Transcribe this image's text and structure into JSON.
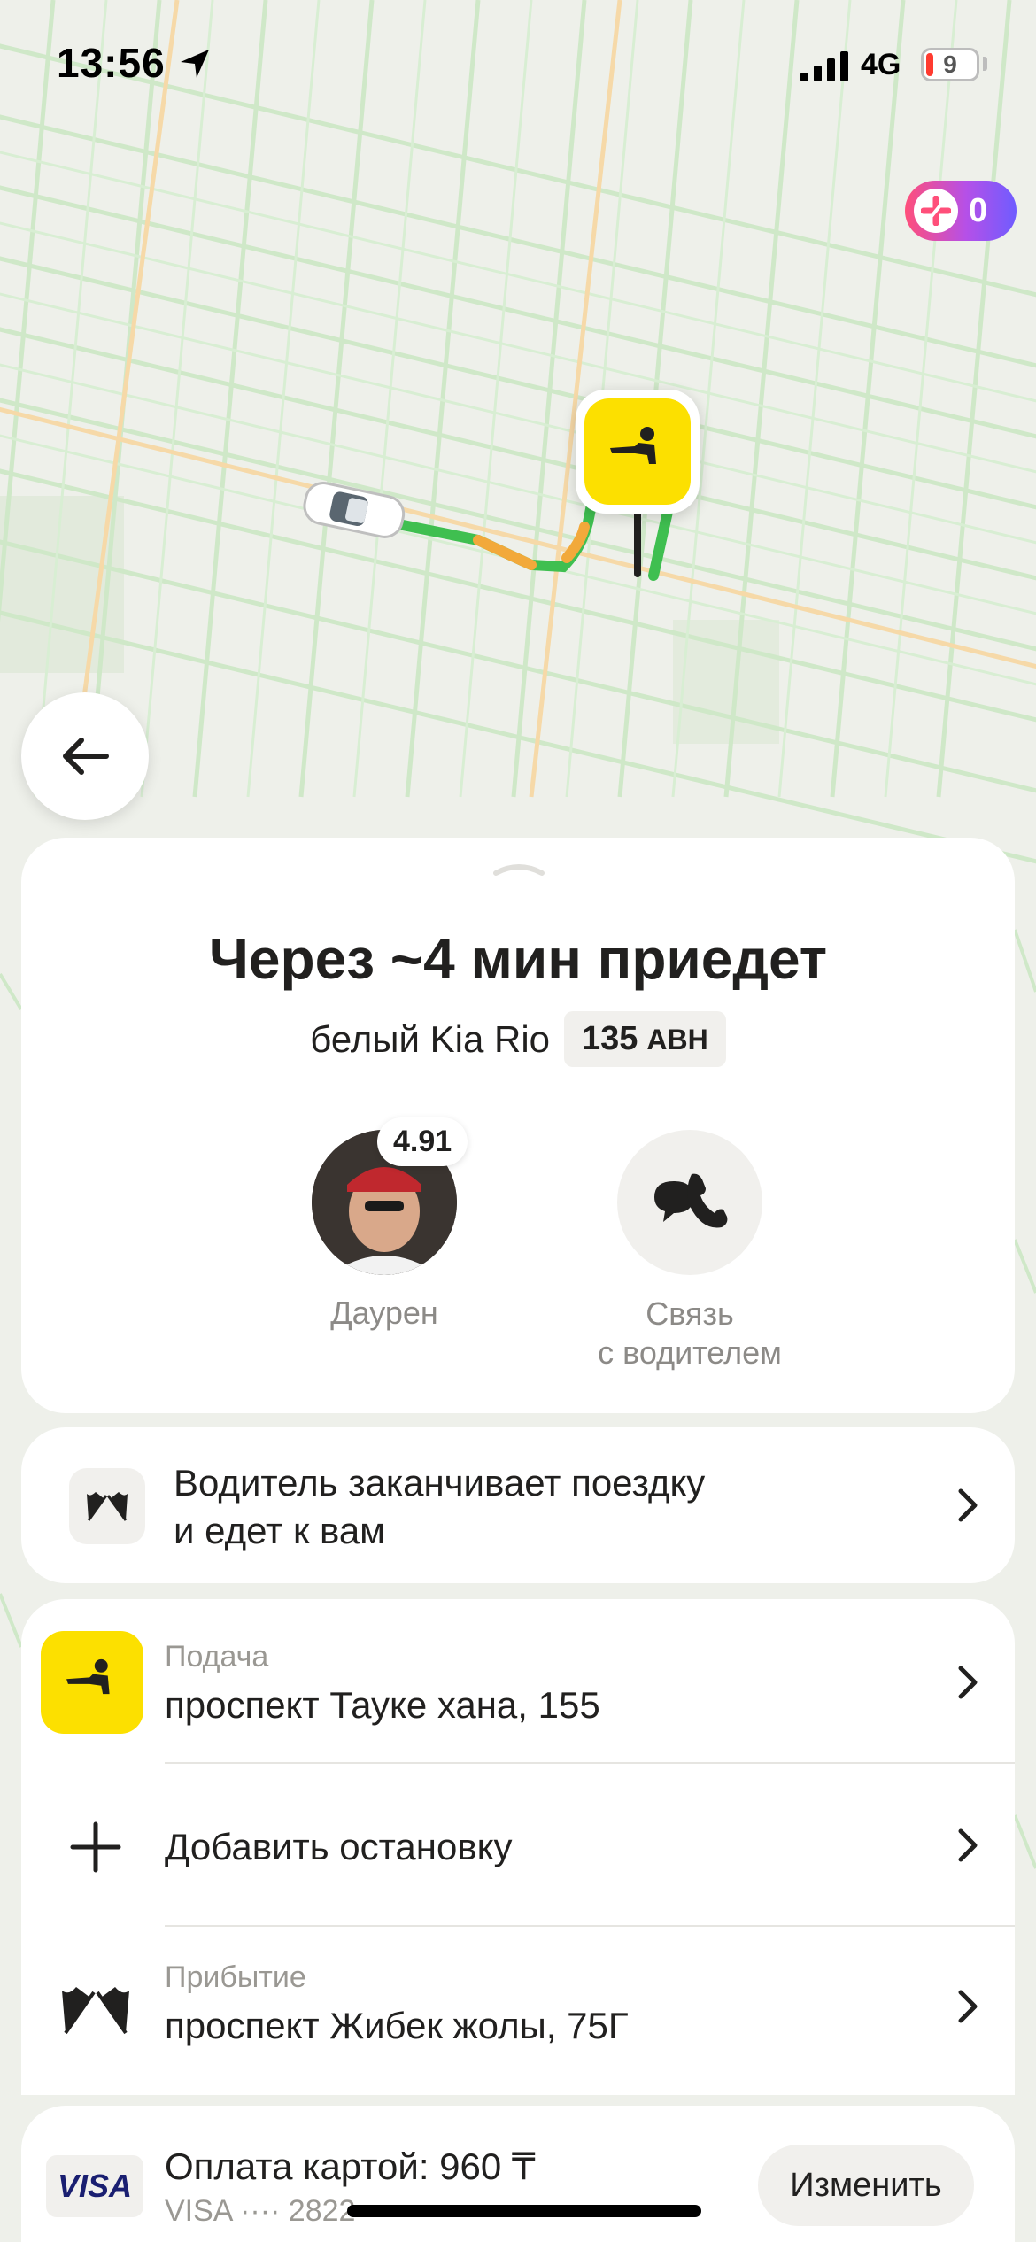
{
  "status_bar": {
    "time": "13:56",
    "network": "4G",
    "battery": "9"
  },
  "plus_badge": {
    "count": "0"
  },
  "trip": {
    "eta_title": "Через ~4 мин приедет",
    "car": "белый Kia Rio",
    "plate_number": "135",
    "plate_suffix": "АВН"
  },
  "driver": {
    "name": "Даурен",
    "rating": "4.91"
  },
  "contact": {
    "label_line1": "Связь",
    "label_line2": "с водителем"
  },
  "status_notice": {
    "line1": "Водитель заканчивает поездку",
    "line2": "и едет к вам"
  },
  "route": {
    "pickup_label": "Подача",
    "pickup_address": "проспект Тауке хана, 155",
    "add_stop": "Добавить остановку",
    "arrival_label": "Прибытие",
    "arrival_address": "проспект Жибек жолы, 75Г"
  },
  "payment": {
    "title": "Оплата картой: 960 ₸",
    "card_masked": "VISA ···· 2822",
    "logo": "VISA",
    "change_button": "Изменить"
  },
  "colors": {
    "accent_yellow": "#fce000",
    "route_green": "#3fbf50",
    "route_orange": "#f2a93b"
  }
}
